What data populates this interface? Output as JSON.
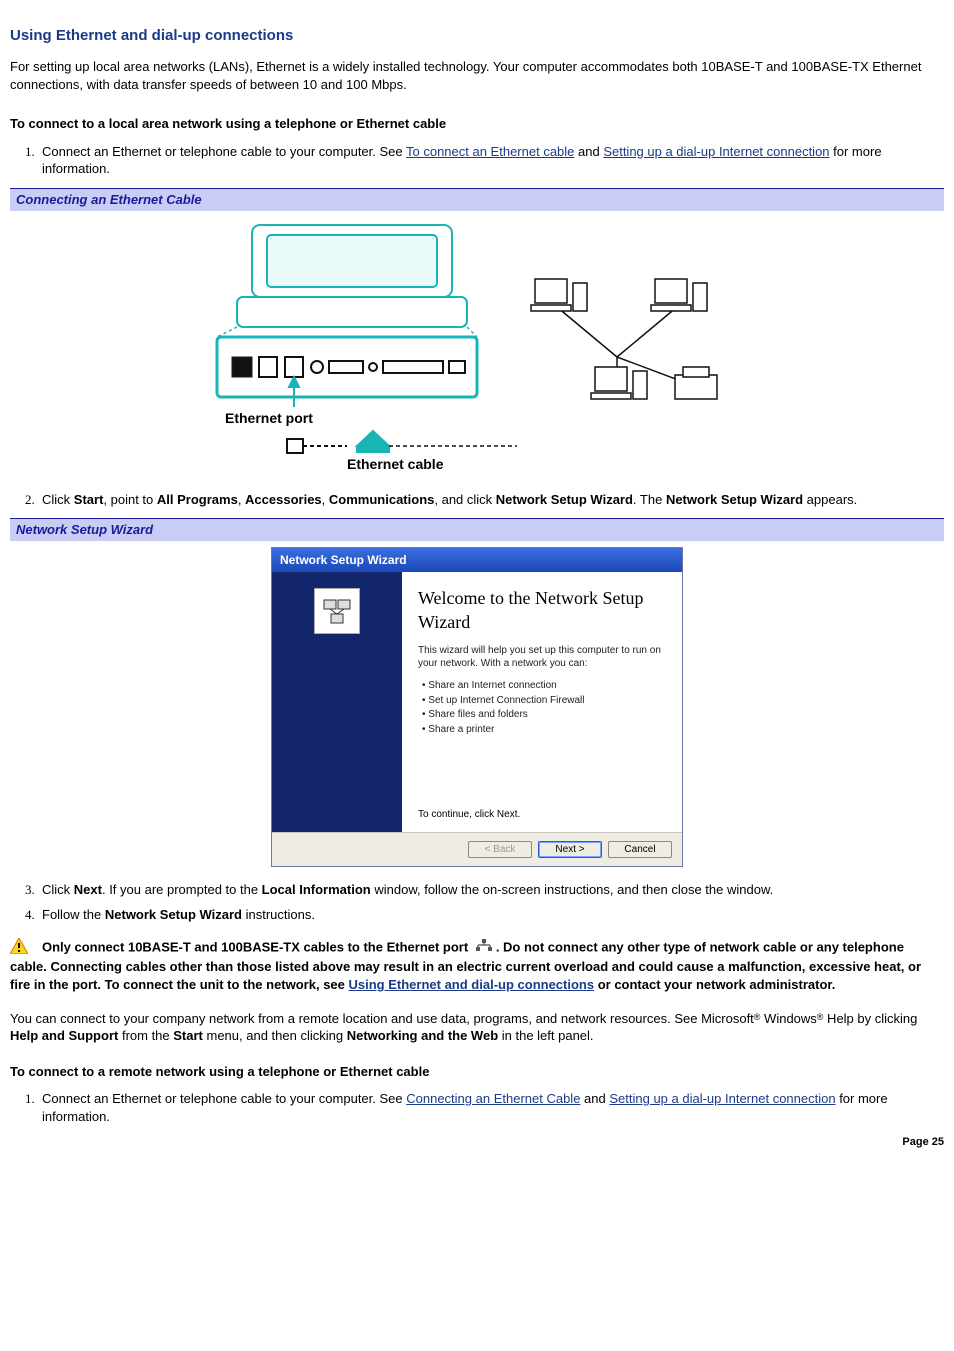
{
  "title": "Using Ethernet and dial-up connections",
  "intro": "For setting up local area networks (LANs), Ethernet is a widely installed technology. Your computer accommodates both 10BASE-T and 100BASE-TX Ethernet connections, with data transfer speeds of between 10 and 100 Mbps.",
  "sub1": "To connect to a local area network using a telephone or Ethernet cable",
  "step1_pre": "Connect an Ethernet or telephone cable to your computer. See ",
  "step1_link1": "To connect an Ethernet cable",
  "step1_mid": " and ",
  "step1_link2": "Setting up a dial-up Internet connection",
  "step1_post": " for more information.",
  "figbar1": "Connecting an Ethernet Cable",
  "eth_port_label": "Ethernet port",
  "eth_cable_label": "Ethernet cable",
  "step2_a": "Click ",
  "step2_b": "Start",
  "step2_c": ", point to ",
  "step2_d": "All Programs",
  "step2_e": ", ",
  "step2_f": "Accessories",
  "step2_g": ", ",
  "step2_h": "Communications",
  "step2_i": ", and click ",
  "step2_j": "Network Setup Wizard",
  "step2_k": ". The ",
  "step2_l": "Network Setup Wizard",
  "step2_m": " appears.",
  "figbar2": "Network Setup Wizard",
  "wiz": {
    "titlebar": "Network Setup Wizard",
    "heading": "Welcome to the Network Setup Wizard",
    "text": "This wizard will help you set up this computer to run on your network. With a network you can:",
    "bullets": {
      "0": "Share an Internet connection",
      "1": "Set up Internet Connection Firewall",
      "2": "Share files and folders",
      "3": "Share a printer"
    },
    "continue": "To continue, click Next.",
    "back": "< Back",
    "next": "Next >",
    "cancel": "Cancel"
  },
  "step3_a": "Click ",
  "step3_b": "Next",
  "step3_c": ". If you are prompted to the ",
  "step3_d": "Local Information",
  "step3_e": " window, follow the on-screen instructions, and then close the window.",
  "step4_a": "Follow the ",
  "step4_b": "Network Setup Wizard",
  "step4_c": " instructions.",
  "warn_a": "Only connect 10BASE-T and 100BASE-TX cables to the Ethernet port ",
  "warn_b": ". Do not connect any other type of network cable or any telephone cable. Connecting cables other than those listed above may result in an electric current overload and could cause a malfunction, excessive heat, or fire in the port. To connect the unit to the network, see ",
  "warn_link": "Using Ethernet and dial-up connections",
  "warn_c": " or contact your network administrator.",
  "remote_a": "You can connect to your company network from a remote location and use data, programs, and network resources. See Microsoft",
  "remote_b": " Windows",
  "remote_c": " Help by clicking ",
  "remote_d": "Help and Support",
  "remote_e": " from the ",
  "remote_f": "Start",
  "remote_g": " menu, and then clicking ",
  "remote_h": "Networking and the Web",
  "remote_i": " in the left panel.",
  "reg": "®",
  "sub2": "To connect to a remote network using a telephone or Ethernet cable",
  "r_step1_pre": "Connect an Ethernet or telephone cable to your computer. See ",
  "r_step1_link1": "Connecting an Ethernet Cable",
  "r_step1_mid": " and ",
  "r_step1_link2": "Setting up a dial-up Internet connection",
  "r_step1_post": " for more information.",
  "page": "Page 25"
}
